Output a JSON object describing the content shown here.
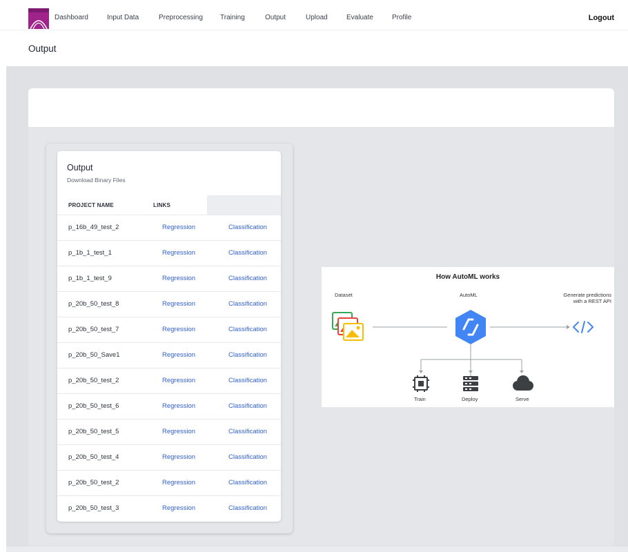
{
  "nav": {
    "items": [
      "Dashboard",
      "Input Data",
      "Preprocessing",
      "Training",
      "Output",
      "Upload",
      "Evaluate",
      "Profile"
    ],
    "logout": "Logout"
  },
  "page": {
    "title": "Output"
  },
  "card": {
    "title": "Output",
    "subtitle": "Download Binary Files",
    "headers": {
      "project_name": "PROJECT NAME",
      "links": "LINKS"
    },
    "rows": [
      {
        "name": "p_16b_49_test_2",
        "regression": "Regression",
        "classification": "Classification"
      },
      {
        "name": "p_1b_1_test_1",
        "regression": "Regression",
        "classification": "Classification"
      },
      {
        "name": "p_1b_1_test_9",
        "regression": "Regression",
        "classification": "Classification"
      },
      {
        "name": "p_20b_50_test_8",
        "regression": "Regression",
        "classification": "Classification"
      },
      {
        "name": "p_20b_50_test_7",
        "regression": "Regression",
        "classification": "Classification"
      },
      {
        "name": "p_20b_50_Save1",
        "regression": "Regression",
        "classification": "Classification"
      },
      {
        "name": "p_20b_50_test_2",
        "regression": "Regression",
        "classification": "Classification"
      },
      {
        "name": "p_20b_50_test_6",
        "regression": "Regression",
        "classification": "Classification"
      },
      {
        "name": "p_20b_50_test_5",
        "regression": "Regression",
        "classification": "Classification"
      },
      {
        "name": "p_20b_50_test_4",
        "regression": "Regression",
        "classification": "Classification"
      },
      {
        "name": "p_20b_50_test_2",
        "regression": "Regression",
        "classification": "Classification"
      },
      {
        "name": "p_20b_50_test_3",
        "regression": "Regression",
        "classification": "Classification"
      }
    ]
  },
  "diagram": {
    "title": "How AutoML works",
    "dataset": "Dataset",
    "automl": "AutoML",
    "predictions_line1": "Generate predictions",
    "predictions_line2": "with a REST API",
    "train": "Train",
    "deploy": "Deploy",
    "serve": "Serve"
  },
  "colors": {
    "link": "#2f5fd0",
    "automl_blue": "#4285f4",
    "logo": "#a0238c"
  }
}
